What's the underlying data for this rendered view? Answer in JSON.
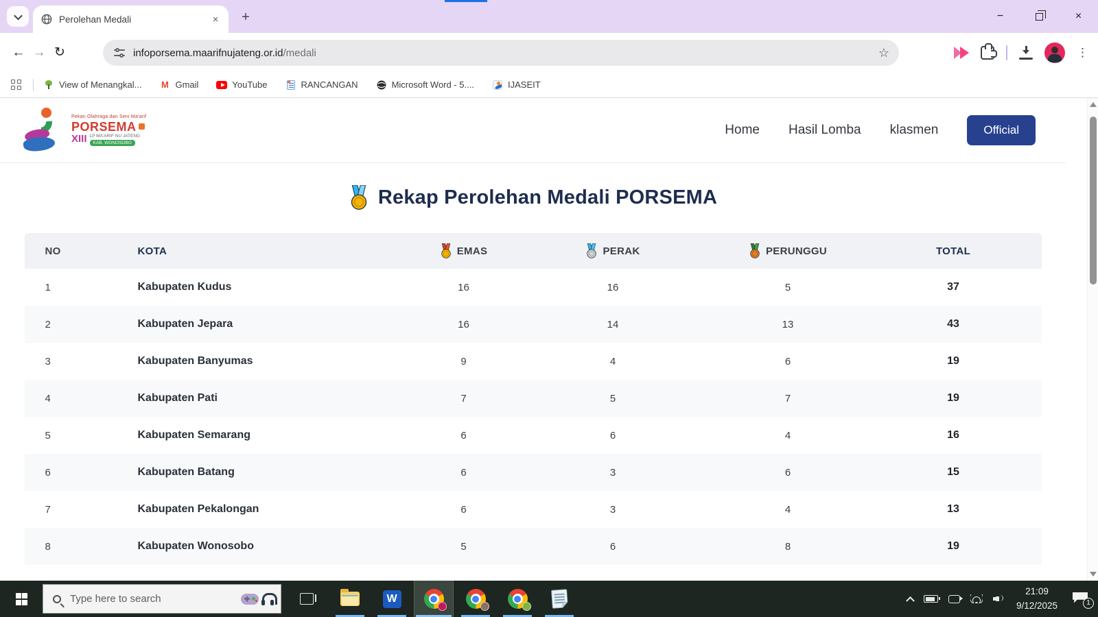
{
  "browser": {
    "tab_title": "Perolehan Medali",
    "url": {
      "domain": "infoporsema.maarifnujateng.or.id",
      "path": "/medali"
    },
    "bookmarks": [
      "View of Menangkal...",
      "Gmail",
      "YouTube",
      "RANCANGAN",
      "Microsoft Word - 5....",
      "IJASEIT"
    ]
  },
  "glyphs": {
    "close": "×",
    "plus": "+",
    "minimize": "−",
    "back": "←",
    "forward": "→",
    "reload": "↻",
    "star": "☆",
    "menu_dots": "⋮",
    "word_letter": "W"
  },
  "site": {
    "logo": {
      "tagline": "Pekan Olahraga dan Seni Ma'arif",
      "name": "PORSEMA",
      "edition": "XIII",
      "org": "LP MA'ARIF NU JATENG",
      "badge": "KAB. WONOSOBO"
    },
    "nav": [
      "Home",
      "Hasil Lomba",
      "klasmen"
    ],
    "official_label": "Official",
    "title": "Rekap Perolehan Medali PORSEMA"
  },
  "table": {
    "headers": {
      "no": "NO",
      "kota": "KOTA",
      "emas": "EMAS",
      "perak": "PERAK",
      "perunggu": "PERUNGGU",
      "total": "TOTAL"
    },
    "rows": [
      {
        "no": "1",
        "kota": "Kabupaten Kudus",
        "emas": "16",
        "perak": "16",
        "perunggu": "5",
        "total": "37"
      },
      {
        "no": "2",
        "kota": "Kabupaten Jepara",
        "emas": "16",
        "perak": "14",
        "perunggu": "13",
        "total": "43"
      },
      {
        "no": "3",
        "kota": "Kabupaten Banyumas",
        "emas": "9",
        "perak": "4",
        "perunggu": "6",
        "total": "19"
      },
      {
        "no": "4",
        "kota": "Kabupaten Pati",
        "emas": "7",
        "perak": "5",
        "perunggu": "7",
        "total": "19"
      },
      {
        "no": "5",
        "kota": "Kabupaten Semarang",
        "emas": "6",
        "perak": "6",
        "perunggu": "4",
        "total": "16"
      },
      {
        "no": "6",
        "kota": "Kabupaten Batang",
        "emas": "6",
        "perak": "3",
        "perunggu": "6",
        "total": "15"
      },
      {
        "no": "7",
        "kota": "Kabupaten Pekalongan",
        "emas": "6",
        "perak": "3",
        "perunggu": "4",
        "total": "13"
      },
      {
        "no": "8",
        "kota": "Kabupaten Wonosobo",
        "emas": "5",
        "perak": "6",
        "perunggu": "8",
        "total": "19"
      }
    ]
  },
  "taskbar": {
    "search_placeholder": "Type here to search",
    "clock": {
      "time": "21:09",
      "date": "9/12/2025"
    },
    "notification_count": "1"
  },
  "colors": {
    "accent_navy": "#1e2d4f",
    "official_blue": "#27418f",
    "tabbar_lavender": "#e6d6f5",
    "taskbar_dark": "#1d2620"
  }
}
